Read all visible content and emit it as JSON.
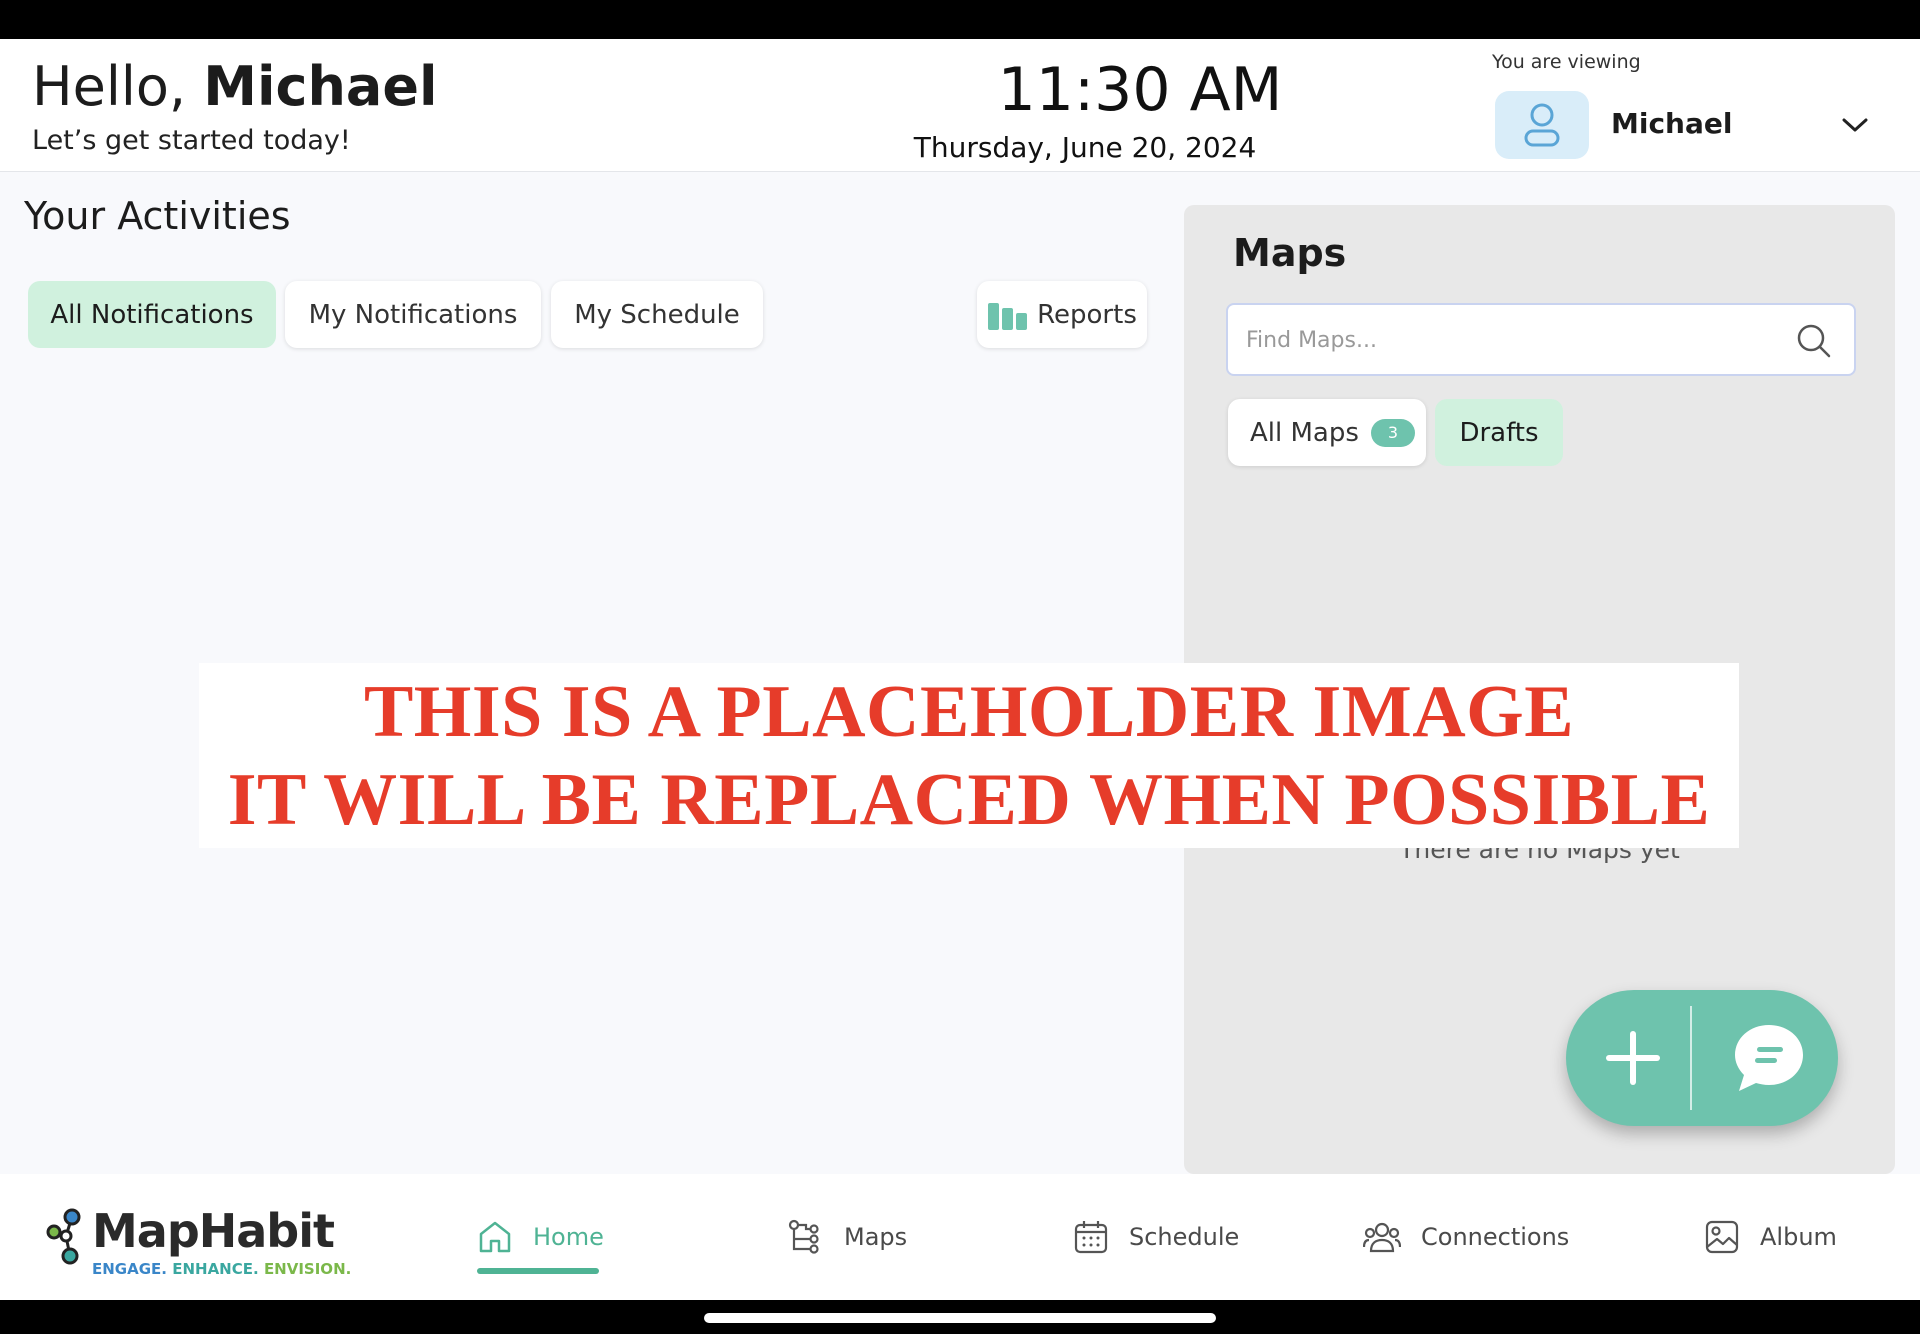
{
  "header": {
    "greeting_prefix": "Hello, ",
    "greeting_name": "Michael",
    "subtitle": "Let’s get started today!",
    "time": "11:30 AM",
    "date": "Thursday, June 20, 2024",
    "viewing_label": "You are viewing",
    "viewing_user": "Michael"
  },
  "activities": {
    "title": "Your Activities",
    "tabs": [
      {
        "label": "All Notifications",
        "active": true
      },
      {
        "label": "My Notifications",
        "active": false
      },
      {
        "label": "My Schedule",
        "active": false
      }
    ],
    "reports_label": "Reports"
  },
  "maps": {
    "title": "Maps",
    "search_placeholder": "Find Maps...",
    "all_label": "All Maps",
    "all_count": "3",
    "drafts_label": "Drafts",
    "empty_text": "There are no Maps yet"
  },
  "placeholder": {
    "line1": "THIS IS A PLACEHOLDER IMAGE",
    "line2": "IT WILL BE REPLACED WHEN POSSIBLE"
  },
  "brand": {
    "name": "MapHabit",
    "tag1": "ENGAGE.",
    "tag2": "ENHANCE.",
    "tag3": "ENVISION."
  },
  "nav": {
    "items": [
      {
        "label": "Home",
        "icon": "home-icon",
        "active": true
      },
      {
        "label": "Maps",
        "icon": "map-tree-icon",
        "active": false
      },
      {
        "label": "Schedule",
        "icon": "calendar-icon",
        "active": false
      },
      {
        "label": "Connections",
        "icon": "connections-icon",
        "active": false
      },
      {
        "label": "Album",
        "icon": "album-icon",
        "active": false
      }
    ]
  },
  "colors": {
    "accent": "#6ec3ad",
    "accent_dark": "#4fb394",
    "active_tab_bg": "#d0f1de",
    "panel_bg": "#e8e8e8",
    "placeholder_text": "#e63c2a"
  }
}
